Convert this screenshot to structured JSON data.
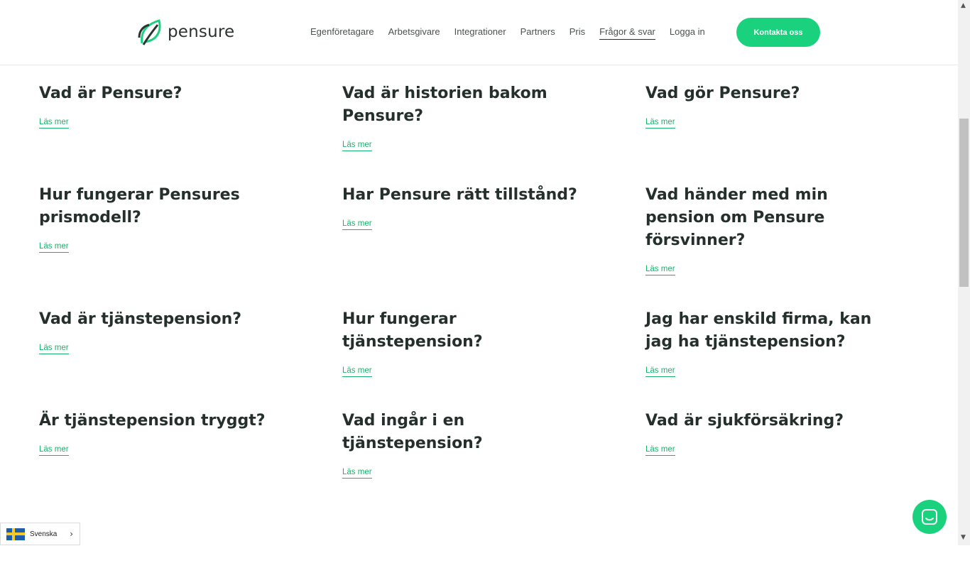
{
  "header": {
    "logo_text": "pensure",
    "nav": [
      "Egenföretagare",
      "Arbetsgivare",
      "Integrationer",
      "Partners",
      "Pris",
      "Frågor & svar",
      "Logga in"
    ],
    "active_nav": "Frågor & svar",
    "cta_label": "Kontakta oss"
  },
  "faq": {
    "read_more": "Läs mer",
    "items": [
      "Vad är Pensure?",
      "Vad är historien bakom Pensure?",
      "Vad gör Pensure?",
      "Hur fungerar Pensures prismodell?",
      "Har Pensure rätt tillstånd?",
      "Vad händer med min pension om Pensure försvinner?",
      "Vad är tjänstepension?",
      "Hur fungerar tjänstepension?",
      "Jag har enskild firma, kan jag ha tjänstepension?",
      "Är tjänstepension tryggt?",
      "Vad ingår i en tjänstepension?",
      "Vad är sjukförsäkring?"
    ]
  },
  "language": {
    "label": "Svenska"
  },
  "colors": {
    "accent": "#1ad17d",
    "text": "#25302c"
  }
}
